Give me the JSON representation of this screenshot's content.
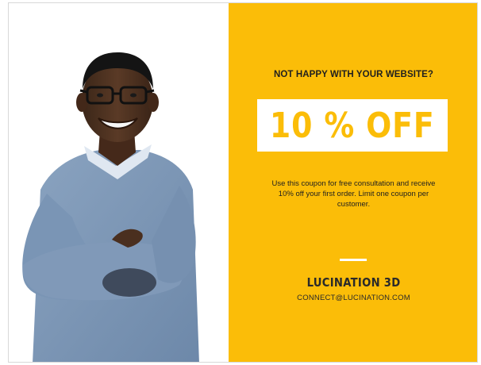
{
  "colors": {
    "accent": "#fbbd08",
    "offer_box_background": "#ffffff",
    "text_dark": "#1f1f1f",
    "sweater": "#7f99b8"
  },
  "photo": {
    "subject": "smiling man with glasses in a light blue sweater, arms crossed"
  },
  "promo": {
    "headline": "NOT HAPPY WITH YOUR WEBSITE?",
    "offer": "10 % OFF",
    "description": "Use this coupon for free consultation and receive 10% off your first order. Limit one coupon per customer.",
    "brand": "LUCINATION 3D",
    "contact": "CONNECT@LUCINATION.COM"
  }
}
